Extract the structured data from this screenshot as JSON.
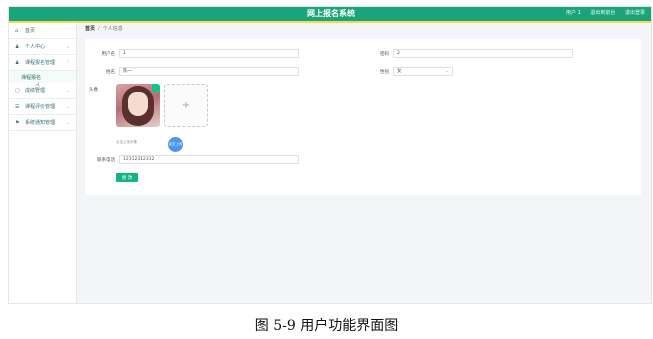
{
  "header": {
    "title": "网上报名系统",
    "user_label": "用户 1",
    "links": [
      "退出到前台",
      "退出登录"
    ]
  },
  "sidebar": {
    "items": [
      {
        "icon": "home-icon",
        "label": "首页"
      },
      {
        "icon": "user-icon",
        "label": "个人中心"
      },
      {
        "icon": "user-icon",
        "label": "课程报名管理",
        "sub": "课程报名"
      },
      {
        "icon": "grid-icon",
        "label": "成绩管理"
      },
      {
        "icon": "list-icon",
        "label": "课程评价管理"
      },
      {
        "icon": "flag-icon",
        "label": "系统通知管理"
      }
    ]
  },
  "breadcrumb": {
    "home": "首页",
    "sep": "/",
    "current": "个人信息"
  },
  "form": {
    "account_label": "用户名",
    "account_value": "1",
    "name_label": "姓名",
    "name_value": "陈一",
    "password_label": "密码",
    "password_value": "2",
    "gender_label": "性别",
    "gender_value": "女",
    "avatar_label": "头像",
    "upload_plus": "+",
    "upload_hint": "点击上传头像",
    "upload_bubble": "点击上传",
    "phone_label": "联系电话",
    "phone_value": "12312312312",
    "submit_label": "修 改"
  },
  "caption": "图 5-9 用户功能界面图",
  "colors": {
    "header": "#1aa47a",
    "accent": "#14b487",
    "topline": "#ffd74a"
  }
}
